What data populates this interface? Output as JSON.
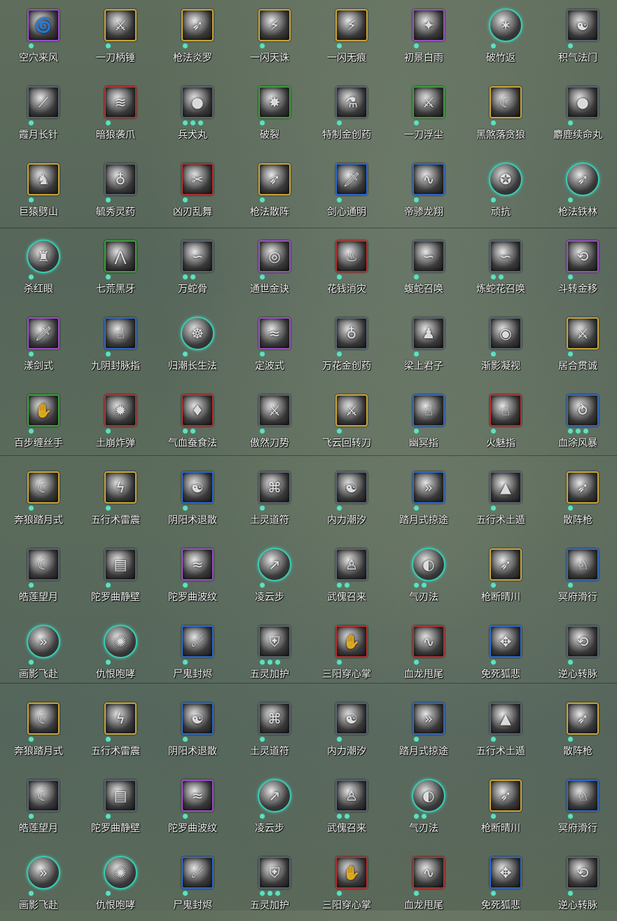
{
  "skills": [
    {
      "label": "空穴来风",
      "frame": "purple",
      "dots": 1,
      "icon": "wind-swirl-icon"
    },
    {
      "label": "一刀柄锤",
      "frame": "gold",
      "dots": 1,
      "icon": "blade-strike-icon"
    },
    {
      "label": "枪法炎罗",
      "frame": "gold",
      "dots": 1,
      "icon": "spear-icon"
    },
    {
      "label": "一闪天诛",
      "frame": "gold",
      "dots": 1,
      "icon": "flash-strike-icon"
    },
    {
      "label": "一闪无痕",
      "frame": "gold",
      "dots": 1,
      "icon": "flash-strike-icon"
    },
    {
      "label": "初景白雨",
      "frame": "purple",
      "dots": 1,
      "icon": "light-beam-icon"
    },
    {
      "label": "破竹返",
      "frame": "cyan",
      "dots": 1,
      "icon": "bamboo-icon"
    },
    {
      "label": "积气法门",
      "frame": "dark",
      "dots": 1,
      "icon": "qi-icon"
    },
    {
      "label": "霞月长针",
      "frame": "dark",
      "dots": 1,
      "icon": "needle-icon"
    },
    {
      "label": "暗狼袭爪",
      "frame": "red",
      "dots": 1,
      "icon": "claw-icon"
    },
    {
      "label": "兵犬丸",
      "frame": "dark",
      "dots": 3,
      "icon": "pill-icon"
    },
    {
      "label": "破裂",
      "frame": "green",
      "dots": 1,
      "icon": "shatter-icon"
    },
    {
      "label": "特制金创药",
      "frame": "dark",
      "dots": 1,
      "icon": "medicine-icon"
    },
    {
      "label": "一刀浮尘",
      "frame": "green",
      "dots": 1,
      "icon": "blade-strike-icon"
    },
    {
      "label": "黑煞落贪狼",
      "frame": "gold",
      "dots": 1,
      "icon": "wolf-icon"
    },
    {
      "label": "麝鹿续命丸",
      "frame": "dark",
      "dots": 1,
      "icon": "pill-icon"
    },
    {
      "label": "巨猿劈山",
      "frame": "gold",
      "dots": 1,
      "icon": "ape-icon"
    },
    {
      "label": "毓秀灵药",
      "frame": "dark",
      "dots": 1,
      "icon": "gourd-icon"
    },
    {
      "label": "凶刃乱舞",
      "frame": "red",
      "dots": 1,
      "icon": "blades-icon"
    },
    {
      "label": "枪法散阵",
      "frame": "gold",
      "dots": 1,
      "icon": "spear-icon"
    },
    {
      "label": "剑心通明",
      "frame": "blue",
      "dots": 1,
      "icon": "sword-icon"
    },
    {
      "label": "帝骖龙翔",
      "frame": "blue",
      "dots": 1,
      "icon": "dragon-icon"
    },
    {
      "label": "顽抗",
      "frame": "cyan",
      "dots": 1,
      "icon": "resist-icon"
    },
    {
      "label": "枪法铁林",
      "frame": "cyan",
      "dots": 1,
      "icon": "spear-icon"
    },
    {
      "label": "杀红眼",
      "frame": "cyan",
      "dots": 1,
      "icon": "warrior-icon"
    },
    {
      "label": "七荒黑牙",
      "frame": "green",
      "dots": 1,
      "icon": "fang-icon"
    },
    {
      "label": "万蛇骨",
      "frame": "dark",
      "dots": 2,
      "icon": "snake-icon"
    },
    {
      "label": "通世金诀",
      "frame": "purple",
      "dots": 1,
      "icon": "coin-icon"
    },
    {
      "label": "花钱消灾",
      "frame": "red",
      "dots": 1,
      "icon": "money-bag-icon"
    },
    {
      "label": "蝮蛇召唤",
      "frame": "dark",
      "dots": 1,
      "icon": "snake-icon"
    },
    {
      "label": "炼蛇花召唤",
      "frame": "dark",
      "dots": 2,
      "icon": "snake-icon"
    },
    {
      "label": "斗转金移",
      "frame": "purple",
      "dots": 1,
      "icon": "swirl-icon"
    },
    {
      "label": "漾剑式",
      "frame": "purple",
      "dots": 1,
      "icon": "sword-icon"
    },
    {
      "label": "九阴封脉指",
      "frame": "blue",
      "dots": 1,
      "icon": "finger-icon"
    },
    {
      "label": "归潮长生法",
      "frame": "cyan",
      "dots": 1,
      "icon": "meditation-icon"
    },
    {
      "label": "定波式",
      "frame": "purple",
      "dots": 1,
      "icon": "wave-icon"
    },
    {
      "label": "万花金创药",
      "frame": "dark",
      "dots": 1,
      "icon": "gourd-icon"
    },
    {
      "label": "梁上君子",
      "frame": "dark",
      "dots": 1,
      "icon": "thief-icon"
    },
    {
      "label": "渐影凝视",
      "frame": "dark",
      "dots": 1,
      "icon": "eye-icon"
    },
    {
      "label": "居合贯诚",
      "frame": "gold",
      "dots": 1,
      "icon": "blade-strike-icon"
    },
    {
      "label": "百步缠丝手",
      "frame": "green",
      "dots": 1,
      "icon": "hand-icon"
    },
    {
      "label": "土崩炸弹",
      "frame": "red",
      "dots": 1,
      "icon": "bomb-icon"
    },
    {
      "label": "气血蚕食法",
      "frame": "red",
      "dots": 2,
      "icon": "blood-icon"
    },
    {
      "label": "傲然刀势",
      "frame": "dark",
      "dots": 1,
      "icon": "blade-strike-icon"
    },
    {
      "label": "飞云回转刀",
      "frame": "gold",
      "dots": 1,
      "icon": "blade-strike-icon"
    },
    {
      "label": "幽冥指",
      "frame": "blue",
      "dots": 1,
      "icon": "finger-icon"
    },
    {
      "label": "火魅指",
      "frame": "red",
      "dots": 1,
      "icon": "finger-icon"
    },
    {
      "label": "血涂风暴",
      "frame": "blue",
      "dots": 3,
      "icon": "storm-icon"
    },
    {
      "label": "奔狼踏月式",
      "frame": "gold",
      "dots": 1,
      "icon": "wolf-icon"
    },
    {
      "label": "五行术雷震",
      "frame": "gold",
      "dots": 1,
      "icon": "thunder-icon"
    },
    {
      "label": "阴阳术退散",
      "frame": "blue",
      "dots": 1,
      "icon": "yin-yang-icon"
    },
    {
      "label": "土灵道符",
      "frame": "dark",
      "dots": 1,
      "icon": "talisman-icon"
    },
    {
      "label": "内力潮汐",
      "frame": "dark",
      "dots": 1,
      "icon": "qi-icon"
    },
    {
      "label": "踏月式掠途",
      "frame": "blue",
      "dots": 1,
      "icon": "dash-icon"
    },
    {
      "label": "五行术土遁",
      "frame": "dark",
      "dots": 1,
      "icon": "earth-icon"
    },
    {
      "label": "散阵枪",
      "frame": "gold",
      "dots": 1,
      "icon": "spear-icon"
    },
    {
      "label": "皓莲望月",
      "frame": "dark",
      "dots": 1,
      "icon": "moon-icon"
    },
    {
      "label": "陀罗曲静壁",
      "frame": "dark",
      "dots": 1,
      "icon": "wall-icon"
    },
    {
      "label": "陀罗曲波纹",
      "frame": "purple",
      "dots": 1,
      "icon": "wave-icon"
    },
    {
      "label": "凌云步",
      "frame": "cyan",
      "dots": 1,
      "icon": "step-icon"
    },
    {
      "label": "武傀召来",
      "frame": "dark",
      "dots": 2,
      "icon": "puppet-icon"
    },
    {
      "label": "气刃法",
      "frame": "cyan",
      "dots": 2,
      "icon": "blade-wave-icon"
    },
    {
      "label": "枪断晴川",
      "frame": "gold",
      "dots": 1,
      "icon": "spear-icon"
    },
    {
      "label": "冥府滑行",
      "frame": "blue",
      "dots": 1,
      "icon": "horse-icon"
    },
    {
      "label": "画影飞赴",
      "frame": "cyan",
      "dots": 1,
      "icon": "dash-icon"
    },
    {
      "label": "仇恨咆哮",
      "frame": "cyan",
      "dots": 1,
      "icon": "roar-icon"
    },
    {
      "label": "尸鬼封烬",
      "frame": "blue",
      "dots": 1,
      "icon": "ghost-icon"
    },
    {
      "label": "五灵加护",
      "frame": "dark",
      "dots": 3,
      "icon": "shield-icon"
    },
    {
      "label": "三阳穿心掌",
      "frame": "red",
      "dots": 1,
      "icon": "palm-icon"
    },
    {
      "label": "血龙甩尾",
      "frame": "red",
      "dots": 1,
      "icon": "dragon-icon"
    },
    {
      "label": "免死狐悲",
      "frame": "blue",
      "dots": 1,
      "icon": "fox-icon"
    },
    {
      "label": "逆心转脉",
      "frame": "dark",
      "dots": 1,
      "icon": "swirl-icon"
    },
    {
      "label": "奔狼踏月式",
      "frame": "gold",
      "dots": 1,
      "icon": "wolf-icon"
    },
    {
      "label": "五行术雷震",
      "frame": "gold",
      "dots": 1,
      "icon": "thunder-icon"
    },
    {
      "label": "阴阳术退散",
      "frame": "blue",
      "dots": 1,
      "icon": "yin-yang-icon"
    },
    {
      "label": "土灵道符",
      "frame": "dark",
      "dots": 1,
      "icon": "talisman-icon"
    },
    {
      "label": "内力潮汐",
      "frame": "dark",
      "dots": 1,
      "icon": "qi-icon"
    },
    {
      "label": "踏月式掠途",
      "frame": "blue",
      "dots": 1,
      "icon": "dash-icon"
    },
    {
      "label": "五行术土遁",
      "frame": "dark",
      "dots": 1,
      "icon": "earth-icon"
    },
    {
      "label": "散阵枪",
      "frame": "gold",
      "dots": 1,
      "icon": "spear-icon"
    },
    {
      "label": "皓莲望月",
      "frame": "dark",
      "dots": 1,
      "icon": "moon-icon"
    },
    {
      "label": "陀罗曲静壁",
      "frame": "dark",
      "dots": 1,
      "icon": "wall-icon"
    },
    {
      "label": "陀罗曲波纹",
      "frame": "purple",
      "dots": 1,
      "icon": "wave-icon"
    },
    {
      "label": "凌云步",
      "frame": "cyan",
      "dots": 1,
      "icon": "step-icon"
    },
    {
      "label": "武傀召来",
      "frame": "dark",
      "dots": 2,
      "icon": "puppet-icon"
    },
    {
      "label": "气刃法",
      "frame": "cyan",
      "dots": 2,
      "icon": "blade-wave-icon"
    },
    {
      "label": "枪断晴川",
      "frame": "gold",
      "dots": 1,
      "icon": "spear-icon"
    },
    {
      "label": "冥府滑行",
      "frame": "blue",
      "dots": 1,
      "icon": "horse-icon"
    },
    {
      "label": "画影飞赴",
      "frame": "cyan",
      "dots": 1,
      "icon": "dash-icon"
    },
    {
      "label": "仇恨咆哮",
      "frame": "cyan",
      "dots": 1,
      "icon": "roar-icon"
    },
    {
      "label": "尸鬼封烬",
      "frame": "blue",
      "dots": 1,
      "icon": "ghost-icon"
    },
    {
      "label": "五灵加护",
      "frame": "dark",
      "dots": 3,
      "icon": "shield-icon"
    },
    {
      "label": "三阳穿心掌",
      "frame": "red",
      "dots": 1,
      "icon": "palm-icon"
    },
    {
      "label": "血龙甩尾",
      "frame": "red",
      "dots": 1,
      "icon": "dragon-icon"
    },
    {
      "label": "免死狐悲",
      "frame": "blue",
      "dots": 1,
      "icon": "fox-icon"
    },
    {
      "label": "逆心转脉",
      "frame": "dark",
      "dots": 1,
      "icon": "swirl-icon"
    }
  ],
  "colors": {
    "gold": "#c9a43a",
    "purple": "#9b4fc7",
    "green": "#3aa23a",
    "red": "#b33030",
    "blue": "#2f68c9",
    "cyan": "#3cc9b0",
    "dark": "#5a6470",
    "dot": "#5fe0c0"
  }
}
